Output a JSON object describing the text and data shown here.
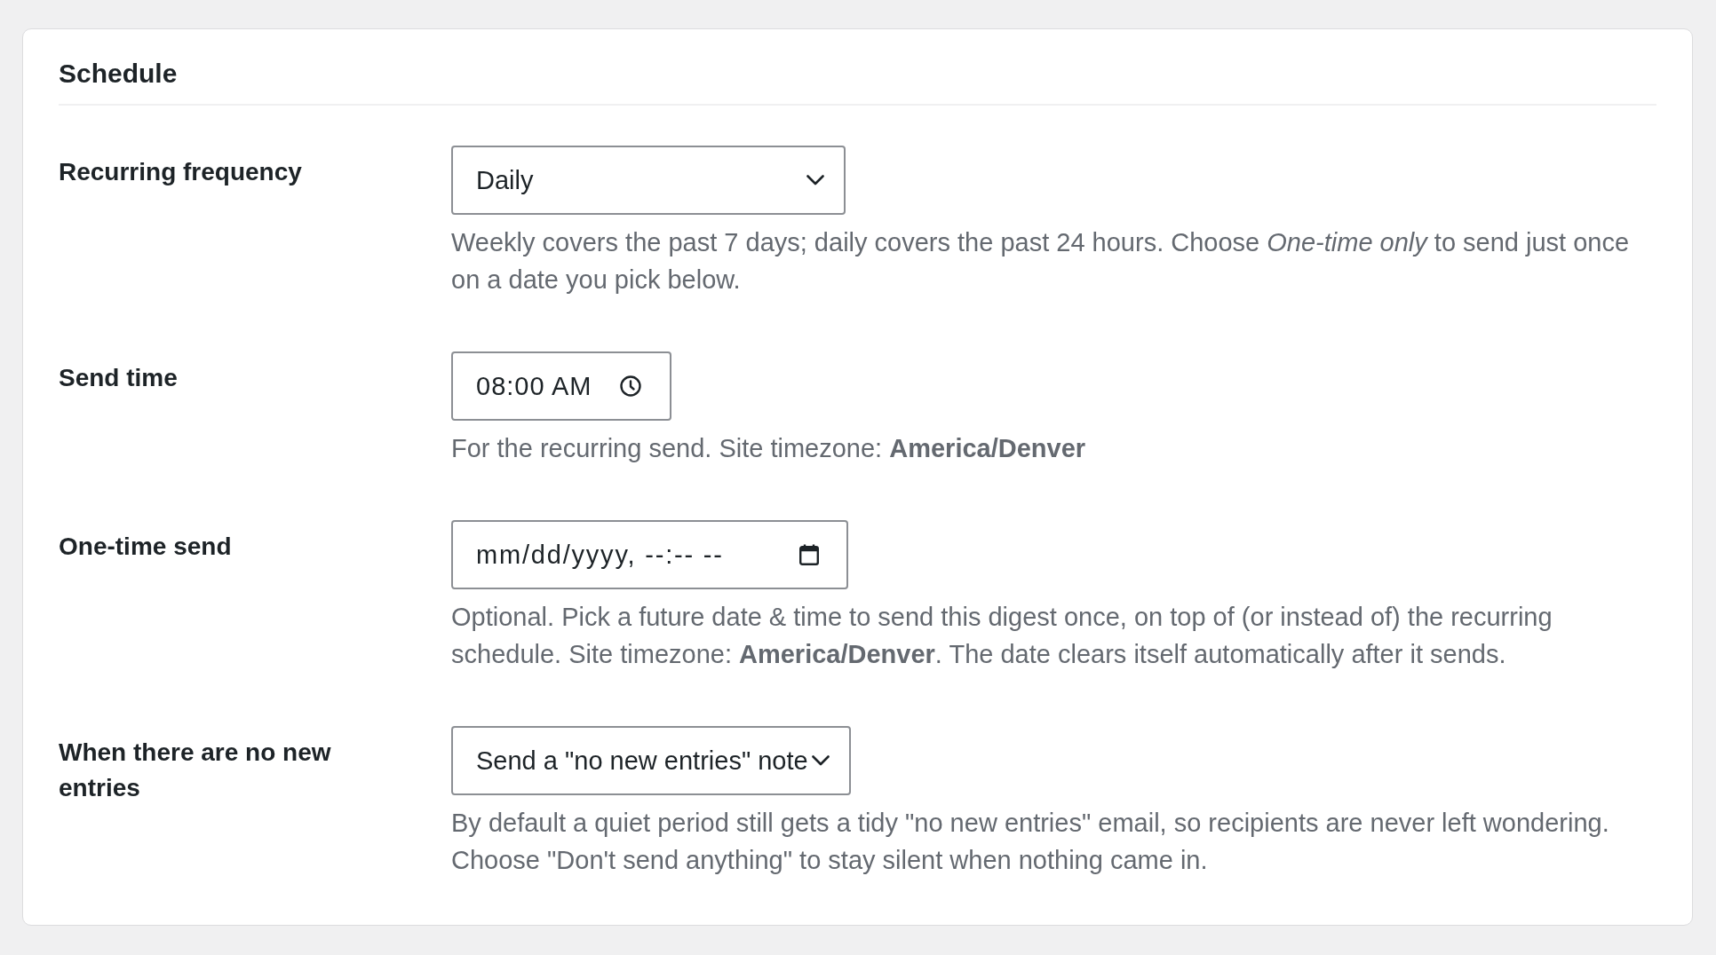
{
  "section": {
    "title": "Schedule"
  },
  "fields": [
    {
      "kind": "select",
      "label": "Recurring frequency",
      "value": "Daily",
      "description": "Weekly covers the past 7 days; daily covers the past 24 hours. Choose *One-time only* to send just once on a date you pick below."
    },
    {
      "kind": "time",
      "label": "Send time",
      "value": "08:00 AM",
      "description": "For the recurring send. Site timezone: **America/Denver**"
    },
    {
      "kind": "datetime",
      "label": "One-time send",
      "placeholder": "mm/dd/yyyy, --:-- --",
      "description": "Optional. Pick a future date & time to send this digest once, on top of (or instead of) the recurring schedule. Site timezone: **America/Denver**. The date clears itself automatically after it sends."
    },
    {
      "kind": "select",
      "label": "When there are no new entries",
      "value": "Send a \"no new entries\" note",
      "description": "By default a quiet period still gets a tidy \"no new entries\" email, so recipients are never left wondering. Choose \"Don't send anything\" to stay silent when nothing came in."
    }
  ]
}
